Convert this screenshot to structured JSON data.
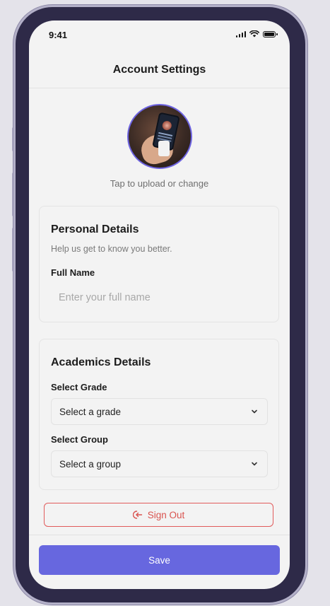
{
  "status_bar": {
    "time": "9:41"
  },
  "header": {
    "title": "Account Settings"
  },
  "avatar": {
    "hint": "Tap to upload or change"
  },
  "personal_details": {
    "title": "Personal Details",
    "subtitle": "Help us get to know you better.",
    "full_name": {
      "label": "Full Name",
      "value": "",
      "placeholder": "Enter your full name"
    }
  },
  "academics_details": {
    "title": "Academics Details",
    "grade": {
      "label": "Select Grade",
      "selected": "Select a grade"
    },
    "group": {
      "label": "Select Group",
      "selected": "Select a group"
    }
  },
  "actions": {
    "sign_out_label": "Sign Out",
    "save_label": "Save"
  },
  "colors": {
    "accent": "#6767df",
    "danger": "#d9534f",
    "frame": "#2e2a48",
    "screen_background": "#f3f3f3"
  },
  "icons": {
    "sign_out": "logout-icon",
    "select_chevron": "chevron-down-icon",
    "signal": "signal-icon",
    "wifi": "wifi-icon",
    "battery": "battery-icon"
  }
}
